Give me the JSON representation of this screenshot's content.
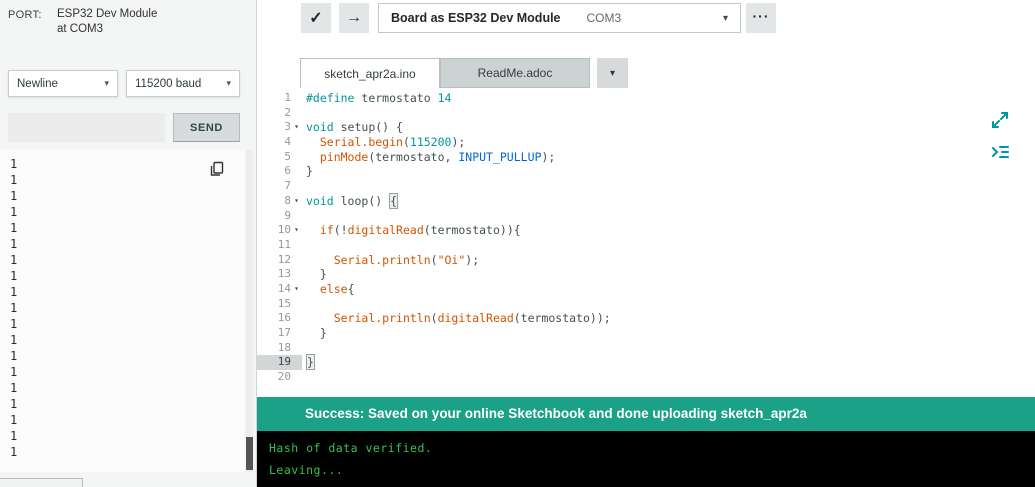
{
  "colors": {
    "accent": "#00979c",
    "success_bar": "#1aa187",
    "console_text": "#35c14e"
  },
  "icons": {
    "chevron_down": "▾",
    "check": "✓",
    "arrow_right": "→",
    "more": "···",
    "fold": "▾"
  },
  "serial_panel": {
    "port_label": "PORT:",
    "board": "ESP32 Dev Module",
    "at_port": "at COM3",
    "line_ending": "Newline",
    "baud_rate": "115200 baud",
    "input_value": "",
    "send_label": "SEND",
    "output_lines": [
      "1",
      "1",
      "1",
      "1",
      "1",
      "1",
      "1",
      "1",
      "1",
      "1",
      "1",
      "1",
      "1",
      "1",
      "1",
      "1",
      "1",
      "1",
      "1"
    ]
  },
  "toolbar": {
    "board_label": "Board as ESP32 Dev Module",
    "port": "COM3"
  },
  "tabs": {
    "items": [
      {
        "label": "sketch_apr2a.ino",
        "active": true
      },
      {
        "label": "ReadMe.adoc",
        "active": false
      }
    ]
  },
  "editor": {
    "lines": [
      {
        "n": 1,
        "tokens": [
          [
            "kw",
            "#define"
          ],
          [
            "pl",
            " termostato "
          ],
          [
            "num",
            "14"
          ]
        ]
      },
      {
        "n": 2,
        "tokens": []
      },
      {
        "n": 3,
        "fold": true,
        "tokens": [
          [
            "kw",
            "void"
          ],
          [
            "pl",
            " setup() {"
          ]
        ]
      },
      {
        "n": 4,
        "tokens": [
          [
            "pl",
            "  "
          ],
          [
            "fn",
            "Serial.begin"
          ],
          [
            "pl",
            "("
          ],
          [
            "num",
            "115200"
          ],
          [
            "pl",
            ");"
          ]
        ]
      },
      {
        "n": 5,
        "tokens": [
          [
            "pl",
            "  "
          ],
          [
            "fn",
            "pinMode"
          ],
          [
            "pl",
            "(termostato, "
          ],
          [
            "const",
            "INPUT_PULLUP"
          ],
          [
            "pl",
            ");"
          ]
        ]
      },
      {
        "n": 6,
        "tokens": [
          [
            "pl",
            "}"
          ]
        ]
      },
      {
        "n": 7,
        "tokens": []
      },
      {
        "n": 8,
        "fold": true,
        "tokens": [
          [
            "kw",
            "void"
          ],
          [
            "pl",
            " loop() "
          ],
          [
            "br",
            "{"
          ]
        ]
      },
      {
        "n": 9,
        "tokens": []
      },
      {
        "n": 10,
        "fold": true,
        "tokens": [
          [
            "pl",
            "  "
          ],
          [
            "ctrl",
            "if"
          ],
          [
            "pl",
            "(!"
          ],
          [
            "fn",
            "digitalRead"
          ],
          [
            "pl",
            "(termostato)){"
          ]
        ]
      },
      {
        "n": 11,
        "tokens": []
      },
      {
        "n": 12,
        "tokens": [
          [
            "pl",
            "    "
          ],
          [
            "fn",
            "Serial.println"
          ],
          [
            "pl",
            "("
          ],
          [
            "str",
            "\"Oi\""
          ],
          [
            "pl",
            ");"
          ]
        ]
      },
      {
        "n": 13,
        "tokens": [
          [
            "pl",
            "  }"
          ]
        ]
      },
      {
        "n": 14,
        "fold": true,
        "tokens": [
          [
            "pl",
            "  "
          ],
          [
            "ctrl",
            "else"
          ],
          [
            "pl",
            "{"
          ]
        ]
      },
      {
        "n": 15,
        "tokens": []
      },
      {
        "n": 16,
        "tokens": [
          [
            "pl",
            "    "
          ],
          [
            "fn",
            "Serial.println"
          ],
          [
            "pl",
            "("
          ],
          [
            "fn",
            "digitalRead"
          ],
          [
            "pl",
            "(termostato));"
          ]
        ]
      },
      {
        "n": 17,
        "tokens": [
          [
            "pl",
            "  }"
          ]
        ]
      },
      {
        "n": 18,
        "tokens": []
      },
      {
        "n": 19,
        "active": true,
        "tokens": [
          [
            "br",
            "}"
          ]
        ]
      },
      {
        "n": 20,
        "tokens": []
      }
    ]
  },
  "status_bar": {
    "message": "Success: Saved on your online Sketchbook and done uploading sketch_apr2a"
  },
  "console": {
    "lines": [
      "Hash of data verified.",
      "Leaving..."
    ]
  }
}
